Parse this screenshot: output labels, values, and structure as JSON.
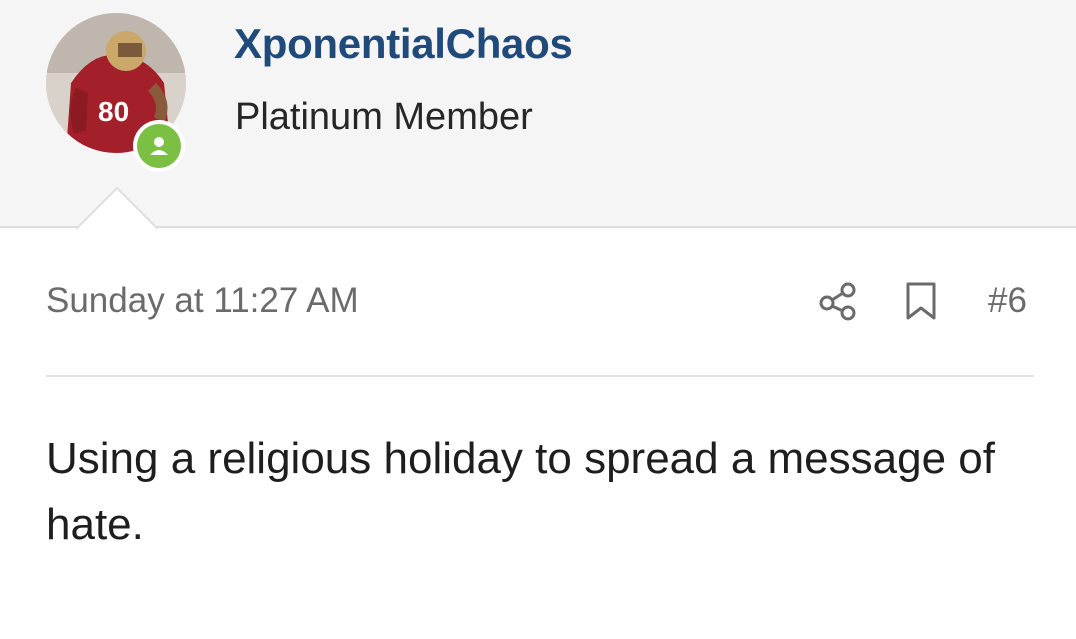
{
  "user": {
    "name": "XponentialChaos",
    "title": "Platinum Member",
    "avatar_icon": "football-player-avatar",
    "online_status_icon": "online-user-icon",
    "online_color": "#7bc043",
    "name_color": "#1f4a7a"
  },
  "post": {
    "timestamp": "Sunday at 11:27 AM",
    "number": "#6",
    "share_icon": "share-icon",
    "bookmark_icon": "bookmark-icon",
    "body": "Using a religious holiday to spread a message of hate."
  }
}
